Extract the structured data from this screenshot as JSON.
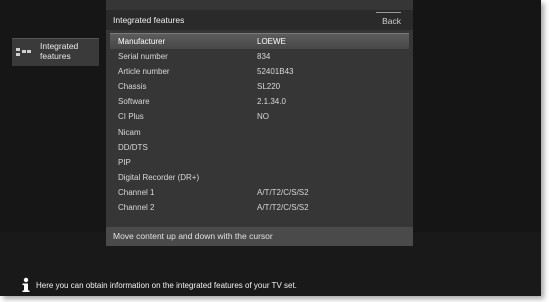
{
  "window": {
    "title": "Integrated features",
    "back_label": "Back"
  },
  "sidebar": {
    "items": [
      {
        "label": "Integrated\nfeatures",
        "icon": "menu-grid-icon"
      }
    ]
  },
  "features": [
    {
      "label": "Manufacturer",
      "value": "LOEWE",
      "selected": true
    },
    {
      "label": "Serial number",
      "value": "834"
    },
    {
      "label": "Article number",
      "value": "52401B43"
    },
    {
      "label": "Chassis",
      "value": "SL220"
    },
    {
      "label": "Software",
      "value": "2.1.34.0"
    },
    {
      "label": "CI Plus",
      "value": "NO"
    },
    {
      "label": "Nicam",
      "value": ""
    },
    {
      "label": "DD/DTS",
      "value": ""
    },
    {
      "label": "PIP",
      "value": ""
    },
    {
      "label": "Digital Recorder (DR+)",
      "value": ""
    },
    {
      "label": "Channel 1",
      "value": "A/T/T2/C/S/S2"
    },
    {
      "label": "Channel 2",
      "value": "A/T/T2/C/S/S2"
    }
  ],
  "hint": "Move content up and down with the cursor",
  "info": {
    "icon": "info-icon",
    "text": "Here you can obtain information on the integrated features of your TV set."
  }
}
